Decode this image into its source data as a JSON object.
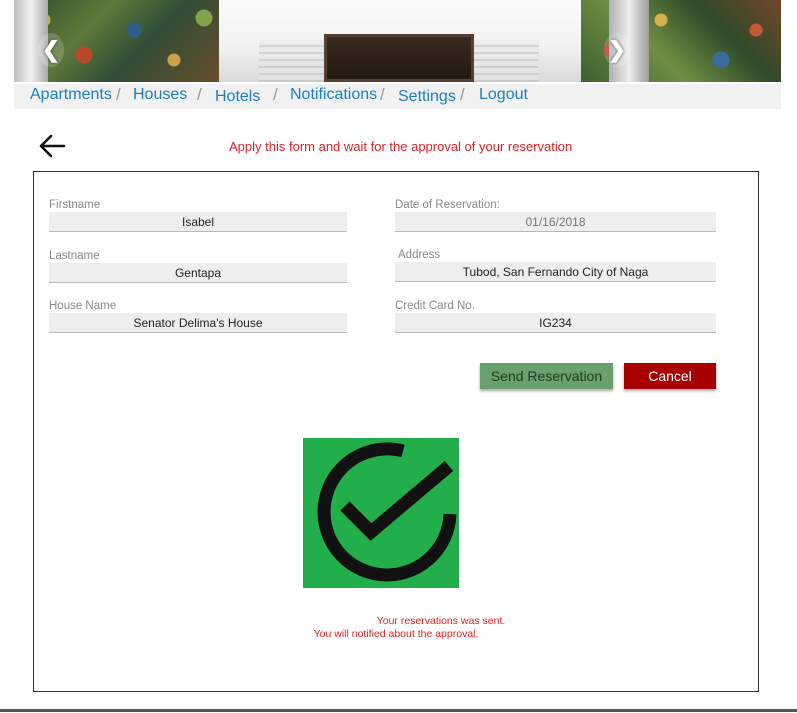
{
  "carousel": {
    "prev_label": "❮",
    "next_label": "❯"
  },
  "nav": {
    "items": [
      {
        "label": "Apartments"
      },
      {
        "label": "Houses"
      },
      {
        "label": "Hotels"
      },
      {
        "label": "Notifications"
      },
      {
        "label": "Settings"
      },
      {
        "label": "Logout"
      }
    ],
    "separator": "/"
  },
  "header": {
    "back_icon": "arrow-left-icon",
    "subtitle": "Apply this form and wait for the approval of your reservation"
  },
  "form": {
    "firstname": {
      "label": "Firstname",
      "value": "Isabel"
    },
    "lastname": {
      "label": "Lastname",
      "value": "Gentapa"
    },
    "house_name": {
      "label": "House Name",
      "value": "Senator Delima's House"
    },
    "date_of_reservation": {
      "label": "Date of Reservation:",
      "value": "01/16/2018"
    },
    "address": {
      "label": "Address",
      "value": "Tubod, San Fernando City of Naga"
    },
    "credit_card": {
      "label": "Credit Card No.",
      "value": "IG234"
    },
    "send_label": "Send Reservation",
    "cancel_label": "Cancel"
  },
  "confirmation": {
    "icon": "check-circle-icon",
    "colors": {
      "background": "#22ae4b",
      "mark": "#111111"
    },
    "line1": "Your reservations was sent.",
    "line2": "You will notified about the approval."
  },
  "colors": {
    "link": "#1a7fc1",
    "alert_text": "#e11f1f",
    "send_button": "#69a06d",
    "cancel_button": "#a80000"
  }
}
